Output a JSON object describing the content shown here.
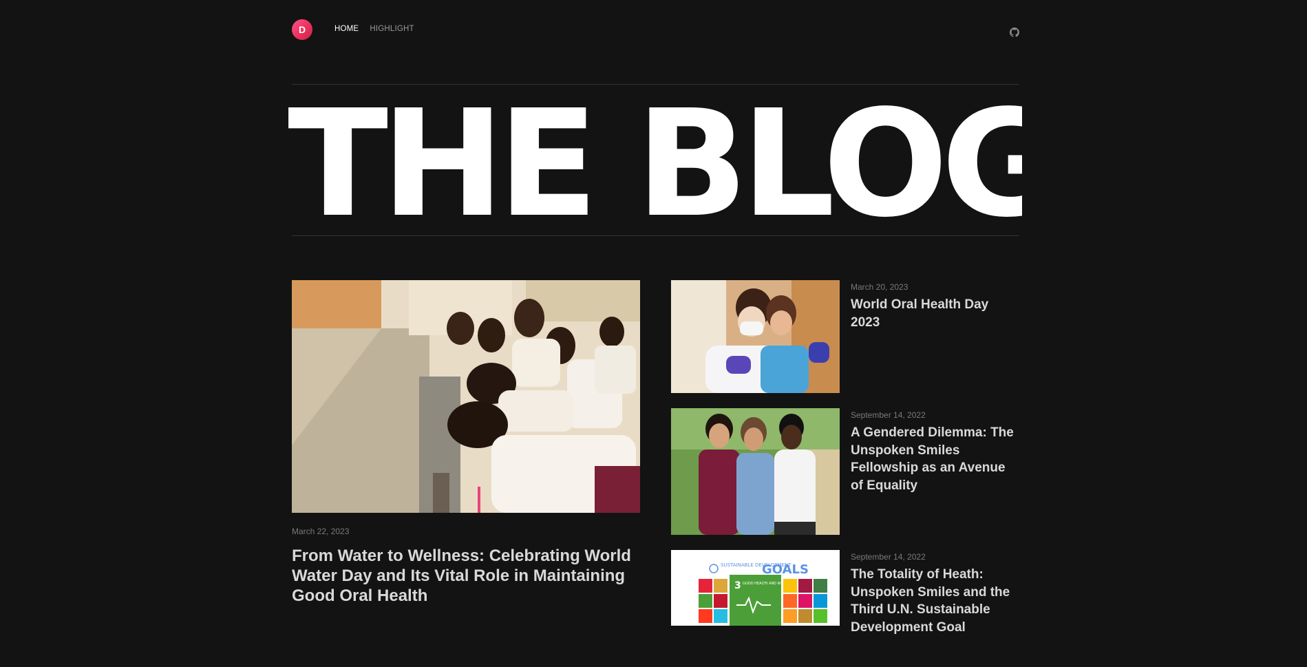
{
  "header": {
    "logo_letter": "D",
    "nav": [
      {
        "label": "HOME",
        "active": true
      },
      {
        "label": "HIGHLIGHT",
        "active": false
      }
    ],
    "github_icon": "github-icon"
  },
  "hero": {
    "title": "THE BLOG"
  },
  "featured": {
    "date": "March 22, 2023",
    "title": "From Water to Wellness: Celebrating World Water Day and Its Vital Role in Maintaining Good Oral Health"
  },
  "posts": [
    {
      "date": "March 20, 2023",
      "title": "World Oral Health Day 2023"
    },
    {
      "date": "September 14, 2022",
      "title": "A Gendered Dilemma: The Unspoken Smiles Fellowship as an Avenue of Equality"
    },
    {
      "date": "September 14, 2022",
      "title": "The Totality of Heath: Unspoken Smiles and the Third U.N. Sustainable Development Goal"
    }
  ],
  "sdg_image": {
    "heading_left": "SUSTAINABLE DEVELOPMENT",
    "heading_right": "GOALS",
    "goal_number": "3",
    "goal_text": "GOOD HEALTH AND WELL-BEING"
  },
  "colors": {
    "background": "#131313",
    "accent_logo": "#e8305a",
    "sdg_green": "#4c9f38"
  }
}
